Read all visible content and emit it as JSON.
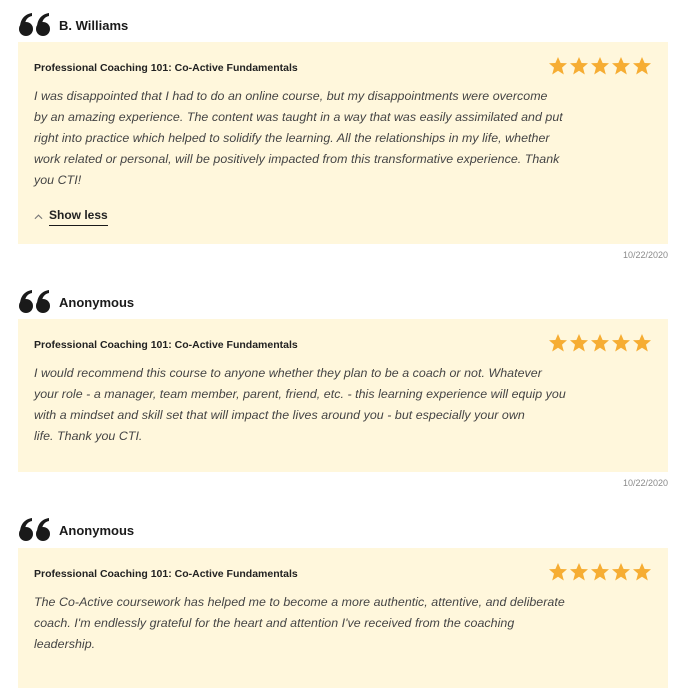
{
  "reviews": [
    {
      "author": "B. Williams",
      "course": "Professional Coaching 101: Co-Active Fundamentals",
      "rating": 5,
      "lines": [
        "I was disappointed that I had to do an online course, but my disappointments were overcome",
        "by an amazing experience. The content was taught in a way that was easily assimilated and put",
        "right into practice which helped to solidify the learning.  All the relationships in my life, whether",
        "work related or personal, will be positively impacted from this transformative experience. Thank",
        "you CTI!"
      ],
      "toggle_label": "Show less",
      "date": "10/22/2020"
    },
    {
      "author": "Anonymous",
      "course": "Professional Coaching 101: Co-Active Fundamentals",
      "rating": 5,
      "lines": [
        "I would recommend this course to anyone whether they plan to be a coach or not. Whatever",
        "your role - a manager, team member, parent, friend, etc. - this learning experience will equip you",
        "with a mindset and skill set that will impact the lives around you - but especially your own",
        "life.  Thank you CTI."
      ],
      "date": "10/22/2020"
    },
    {
      "author": "Anonymous",
      "course": "Professional Coaching 101: Co-Active Fundamentals",
      "rating": 5,
      "lines": [
        "The Co-Active coursework has helped me to become a more authentic, attentive, and deliberate",
        "coach. I'm endlessly grateful for the heart and attention I've received from the coaching",
        "leadership."
      ]
    }
  ],
  "colors": {
    "card_background": "#fff7dc",
    "star": "#f6ad33",
    "quote_icon": "#1a1a1a"
  },
  "icons": {
    "quote": "quote-icon",
    "star": "star-icon",
    "toggle": "chevron-up-icon"
  }
}
